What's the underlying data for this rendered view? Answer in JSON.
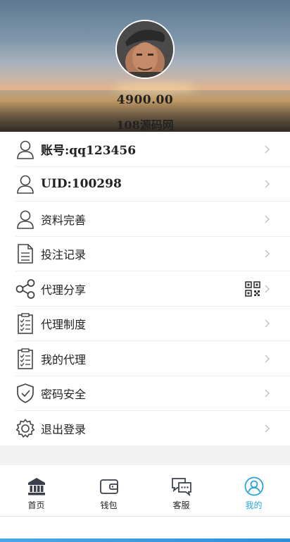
{
  "profile": {
    "balance": "4900.00",
    "site_name": "108源码网"
  },
  "menu": [
    {
      "label": "账号:qq123456",
      "icon": "user-icon"
    },
    {
      "label": "UID:100298",
      "icon": "user-icon"
    },
    {
      "label": "资料完善",
      "icon": "user-icon"
    },
    {
      "label": "投注记录",
      "icon": "document-icon"
    },
    {
      "label": "代理分享",
      "icon": "share-icon"
    },
    {
      "label": "代理制度",
      "icon": "checklist-icon"
    },
    {
      "label": "我的代理",
      "icon": "checklist-icon"
    },
    {
      "label": "密码安全",
      "icon": "shield-check-icon"
    },
    {
      "label": "退出登录",
      "icon": "gear-icon"
    }
  ],
  "tabbar": {
    "items": [
      {
        "label": "首页",
        "icon": "bank-icon"
      },
      {
        "label": "钱包",
        "icon": "wallet-icon"
      },
      {
        "label": "客服",
        "icon": "chat-icon"
      },
      {
        "label": "我的",
        "icon": "profile-icon"
      }
    ],
    "active_color": "#2aa3d8"
  }
}
